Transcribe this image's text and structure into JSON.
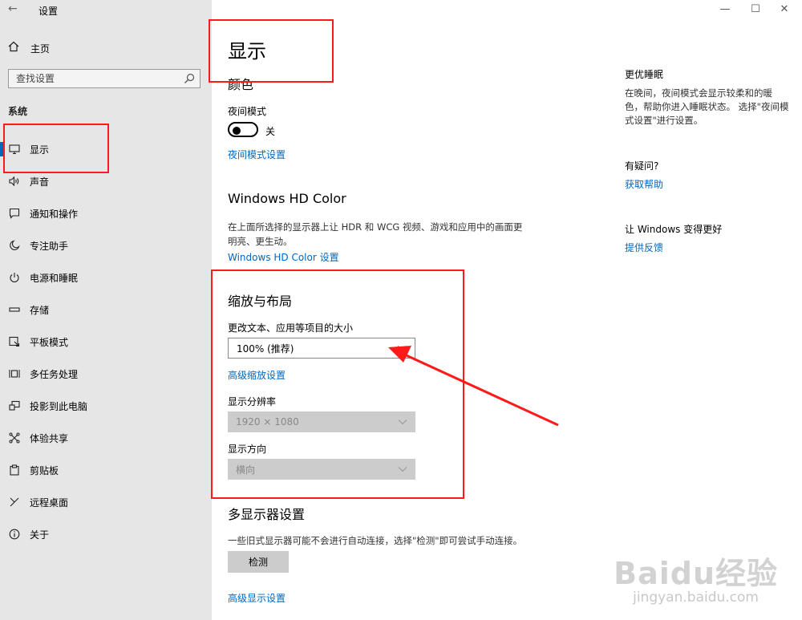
{
  "window": {
    "title": "设置",
    "back_icon": "arrow-left-icon",
    "controls": [
      "minimize",
      "maximize",
      "close"
    ]
  },
  "sidebar": {
    "home_label": "主页",
    "search_placeholder": "查找设置",
    "section_label": "系统",
    "items": [
      {
        "label": "显示",
        "icon": "monitor-icon",
        "active": true
      },
      {
        "label": "声音",
        "icon": "speaker-icon"
      },
      {
        "label": "通知和操作",
        "icon": "notification-icon"
      },
      {
        "label": "专注助手",
        "icon": "moon-icon"
      },
      {
        "label": "电源和睡眠",
        "icon": "power-icon"
      },
      {
        "label": "存储",
        "icon": "storage-icon"
      },
      {
        "label": "平板模式",
        "icon": "tablet-icon"
      },
      {
        "label": "多任务处理",
        "icon": "multitask-icon"
      },
      {
        "label": "投影到此电脑",
        "icon": "project-icon"
      },
      {
        "label": "体验共享",
        "icon": "share-icon"
      },
      {
        "label": "剪贴板",
        "icon": "clipboard-icon"
      },
      {
        "label": "远程桌面",
        "icon": "remote-icon"
      },
      {
        "label": "关于",
        "icon": "info-icon"
      }
    ]
  },
  "main": {
    "page_title": "显示",
    "color_heading": "颜色",
    "night_mode_label": "夜间模式",
    "night_mode_state": "关",
    "night_mode_settings_link": "夜间模式设置",
    "hdr_heading": "Windows HD Color",
    "hdr_desc": "在上面所选择的显示器上让 HDR 和 WCG 视频、游戏和应用中的画面更明亮、更生动。",
    "hdr_link": "Windows HD Color 设置",
    "scale_heading": "缩放与布局",
    "scale_label": "更改文本、应用等项目的大小",
    "scale_value": "100% (推荐)",
    "advanced_scale_link": "高级缩放设置",
    "resolution_label": "显示分辨率",
    "resolution_value": "1920 × 1080",
    "orientation_label": "显示方向",
    "orientation_value": "横向",
    "multi_heading": "多显示器设置",
    "multi_desc": "一些旧式显示器可能不会进行自动连接，选择\"检测\"即可尝试手动连接。",
    "detect_button": "检测",
    "advanced_display_link": "高级显示设置"
  },
  "right": {
    "sleep_heading": "更优睡眠",
    "sleep_desc": "在晚间，夜间模式会显示较柔和的暖色，帮助你进入睡眠状态。 选择\"夜间模式设置\"进行设置。",
    "question_heading": "有疑问?",
    "help_link": "获取帮助",
    "improve_heading": "让 Windows 变得更好",
    "feedback_link": "提供反馈"
  },
  "annotation_color": "#ff1a1a",
  "accent_color": "#0067c0",
  "watermark": {
    "logo": "Baidu经验",
    "url": "jingyan.baidu.com"
  }
}
